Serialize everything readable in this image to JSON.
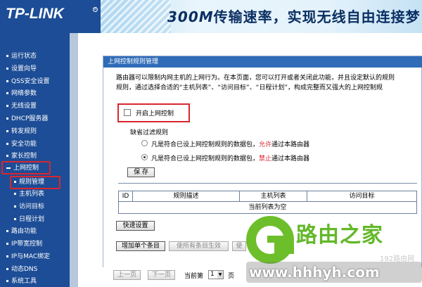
{
  "header": {
    "logo": "TP-LINK",
    "logo_mark": "R",
    "slogan_speed": "300M",
    "slogan_text": "传输速率，实现无线自由连接梦"
  },
  "sidebar": {
    "items": [
      {
        "label": "运行状态"
      },
      {
        "label": "设置向导"
      },
      {
        "label": "QSS安全设置"
      },
      {
        "label": "网络参数"
      },
      {
        "label": "无线设置"
      },
      {
        "label": "DHCP服务器"
      },
      {
        "label": "转发规则"
      },
      {
        "label": "安全功能"
      },
      {
        "label": "家长控制"
      },
      {
        "label": "上网控制"
      },
      {
        "label": "规则管理"
      },
      {
        "label": "主机列表"
      },
      {
        "label": "访问目标"
      },
      {
        "label": "日程计划"
      },
      {
        "label": "路由功能"
      },
      {
        "label": "IP带宽控制"
      },
      {
        "label": "IP与MAC绑定"
      },
      {
        "label": "动态DNS"
      },
      {
        "label": "系统工具"
      }
    ]
  },
  "panel": {
    "title": "上网控制规则管理",
    "desc_line1": "路由器可以限制内网主机的上网行为。在本页面，您可以打开或者关闭此功能，并且设定默认的规则",
    "desc_line2": "规则，通过选择合适的“主机列表”、“访问目标”、“日程计划”，构成完整而又强大的上网控制规",
    "enable_label": "开启上网控制",
    "default_rule_title": "缺省过滤规则",
    "radio1_prefix": "凡是符合已设上网控制规则的数据包，",
    "radio1_keyword": "允许",
    "radio1_suffix": "通过本路由器",
    "radio2_prefix": "凡是符合已设上网控制规则的数据包，",
    "radio2_keyword": "禁止",
    "radio2_suffix": "通过本路由器",
    "save_label": "保 存",
    "table_headers": [
      "ID",
      "规则描述",
      "主机列表",
      "访问目标"
    ],
    "table_empty": "当前列表为空",
    "quick_setup_label": "快速设置",
    "add_label": "增加单个条目",
    "enable_all_label": "使所有条目生效",
    "partial_label": "使",
    "prev_label": "上一页",
    "next_label": "下一页",
    "page_prefix": "当前第",
    "page_value": "1",
    "page_suffix": "页"
  },
  "watermark": {
    "name": "路由之家",
    "url": "www.hhhyh.com",
    "small": "192路由网"
  },
  "colors": {
    "nav_bg": "#1d4d96",
    "highlight": "#d9262f",
    "panel_title_bg": "#2f6cb8",
    "watermark_green": "#63b829"
  }
}
